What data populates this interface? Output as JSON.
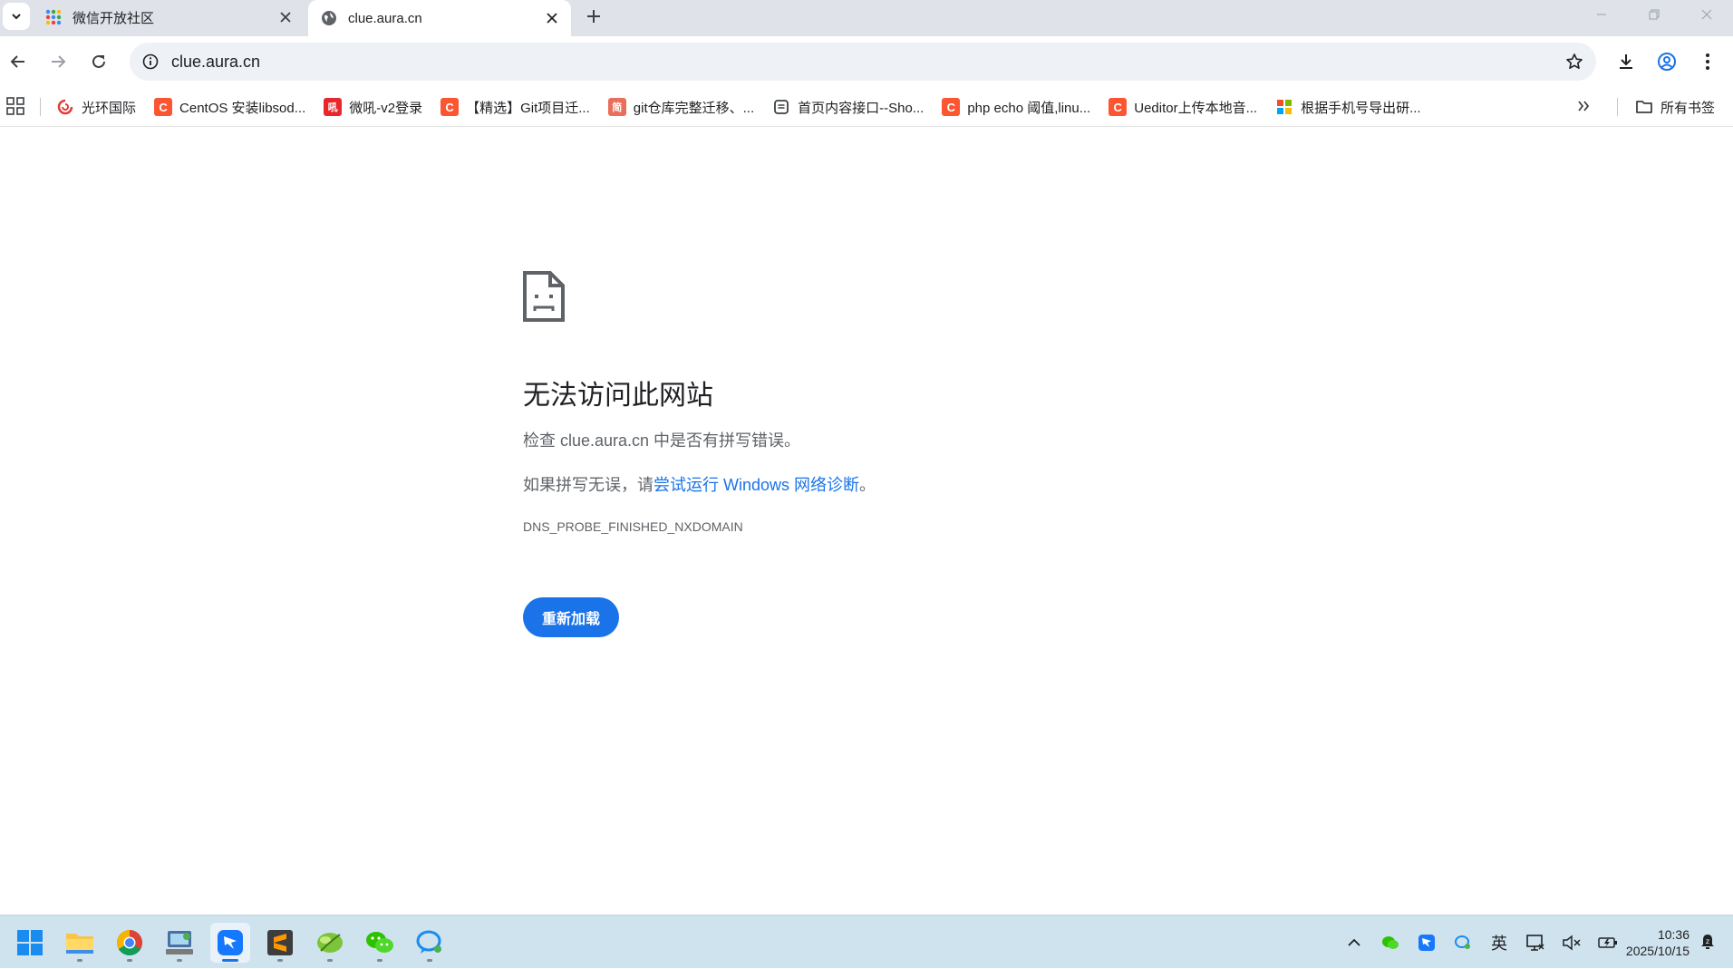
{
  "tabs": [
    {
      "title": "微信开放社区",
      "active": false
    },
    {
      "title": "clue.aura.cn",
      "active": true
    }
  ],
  "omnibox": {
    "url": "clue.aura.cn"
  },
  "bookmarks": {
    "items": [
      {
        "label": "光环国际",
        "icon": "spiral-red-icon",
        "color": "#e53935"
      },
      {
        "label": "CentOS 安装libsod...",
        "icon": "csdn-icon",
        "color": "#fc5531"
      },
      {
        "label": "微吼-v2登录",
        "icon": "vhall-icon",
        "color": "#e8262b"
      },
      {
        "label": "【精选】Git项目迁...",
        "icon": "csdn-icon",
        "color": "#fc5531"
      },
      {
        "label": "git仓库完整迁移、...",
        "icon": "jianshu-icon",
        "color": "#ea6f5a"
      },
      {
        "label": "首页内容接口--Sho...",
        "icon": "doc-icon",
        "color": "#5f6368"
      },
      {
        "label": "php echo 阈值,linu...",
        "icon": "csdn-icon",
        "color": "#fc5531"
      },
      {
        "label": "Ueditor上传本地音...",
        "icon": "csdn-icon",
        "color": "#fc5531"
      },
      {
        "label": "根据手机号导出研...",
        "icon": "colorful-grid-icon",
        "color": "#f4b400"
      }
    ],
    "all_bookmarks": "所有书签"
  },
  "error": {
    "heading": "无法访问此网站",
    "line1": "检查 clue.aura.cn 中是否有拼写错误。",
    "line2_prefix": "如果拼写无误，请",
    "line2_link": "尝试运行 Windows 网络诊断",
    "line2_suffix": "。",
    "code": "DNS_PROBE_FINISHED_NXDOMAIN",
    "reload_label": "重新加载"
  },
  "taskbar": {
    "apps": [
      {
        "name": "file-explorer-icon",
        "active": false
      },
      {
        "name": "chrome-icon",
        "active": false
      },
      {
        "name": "network-app-icon",
        "active": false
      },
      {
        "name": "dingtalk-icon",
        "active": true
      },
      {
        "name": "sublime-text-icon",
        "active": false
      },
      {
        "name": "green-leaf-app-icon",
        "active": false
      },
      {
        "name": "wechat-icon",
        "active": false
      },
      {
        "name": "qq-chat-icon",
        "active": false
      }
    ],
    "ime": "英",
    "time": "10:36",
    "date": "2025/10/15"
  },
  "colors": {
    "accent": "#1a73e8",
    "taskbar": "#cfe3ee",
    "tabstrip": "#dfe3e9"
  }
}
